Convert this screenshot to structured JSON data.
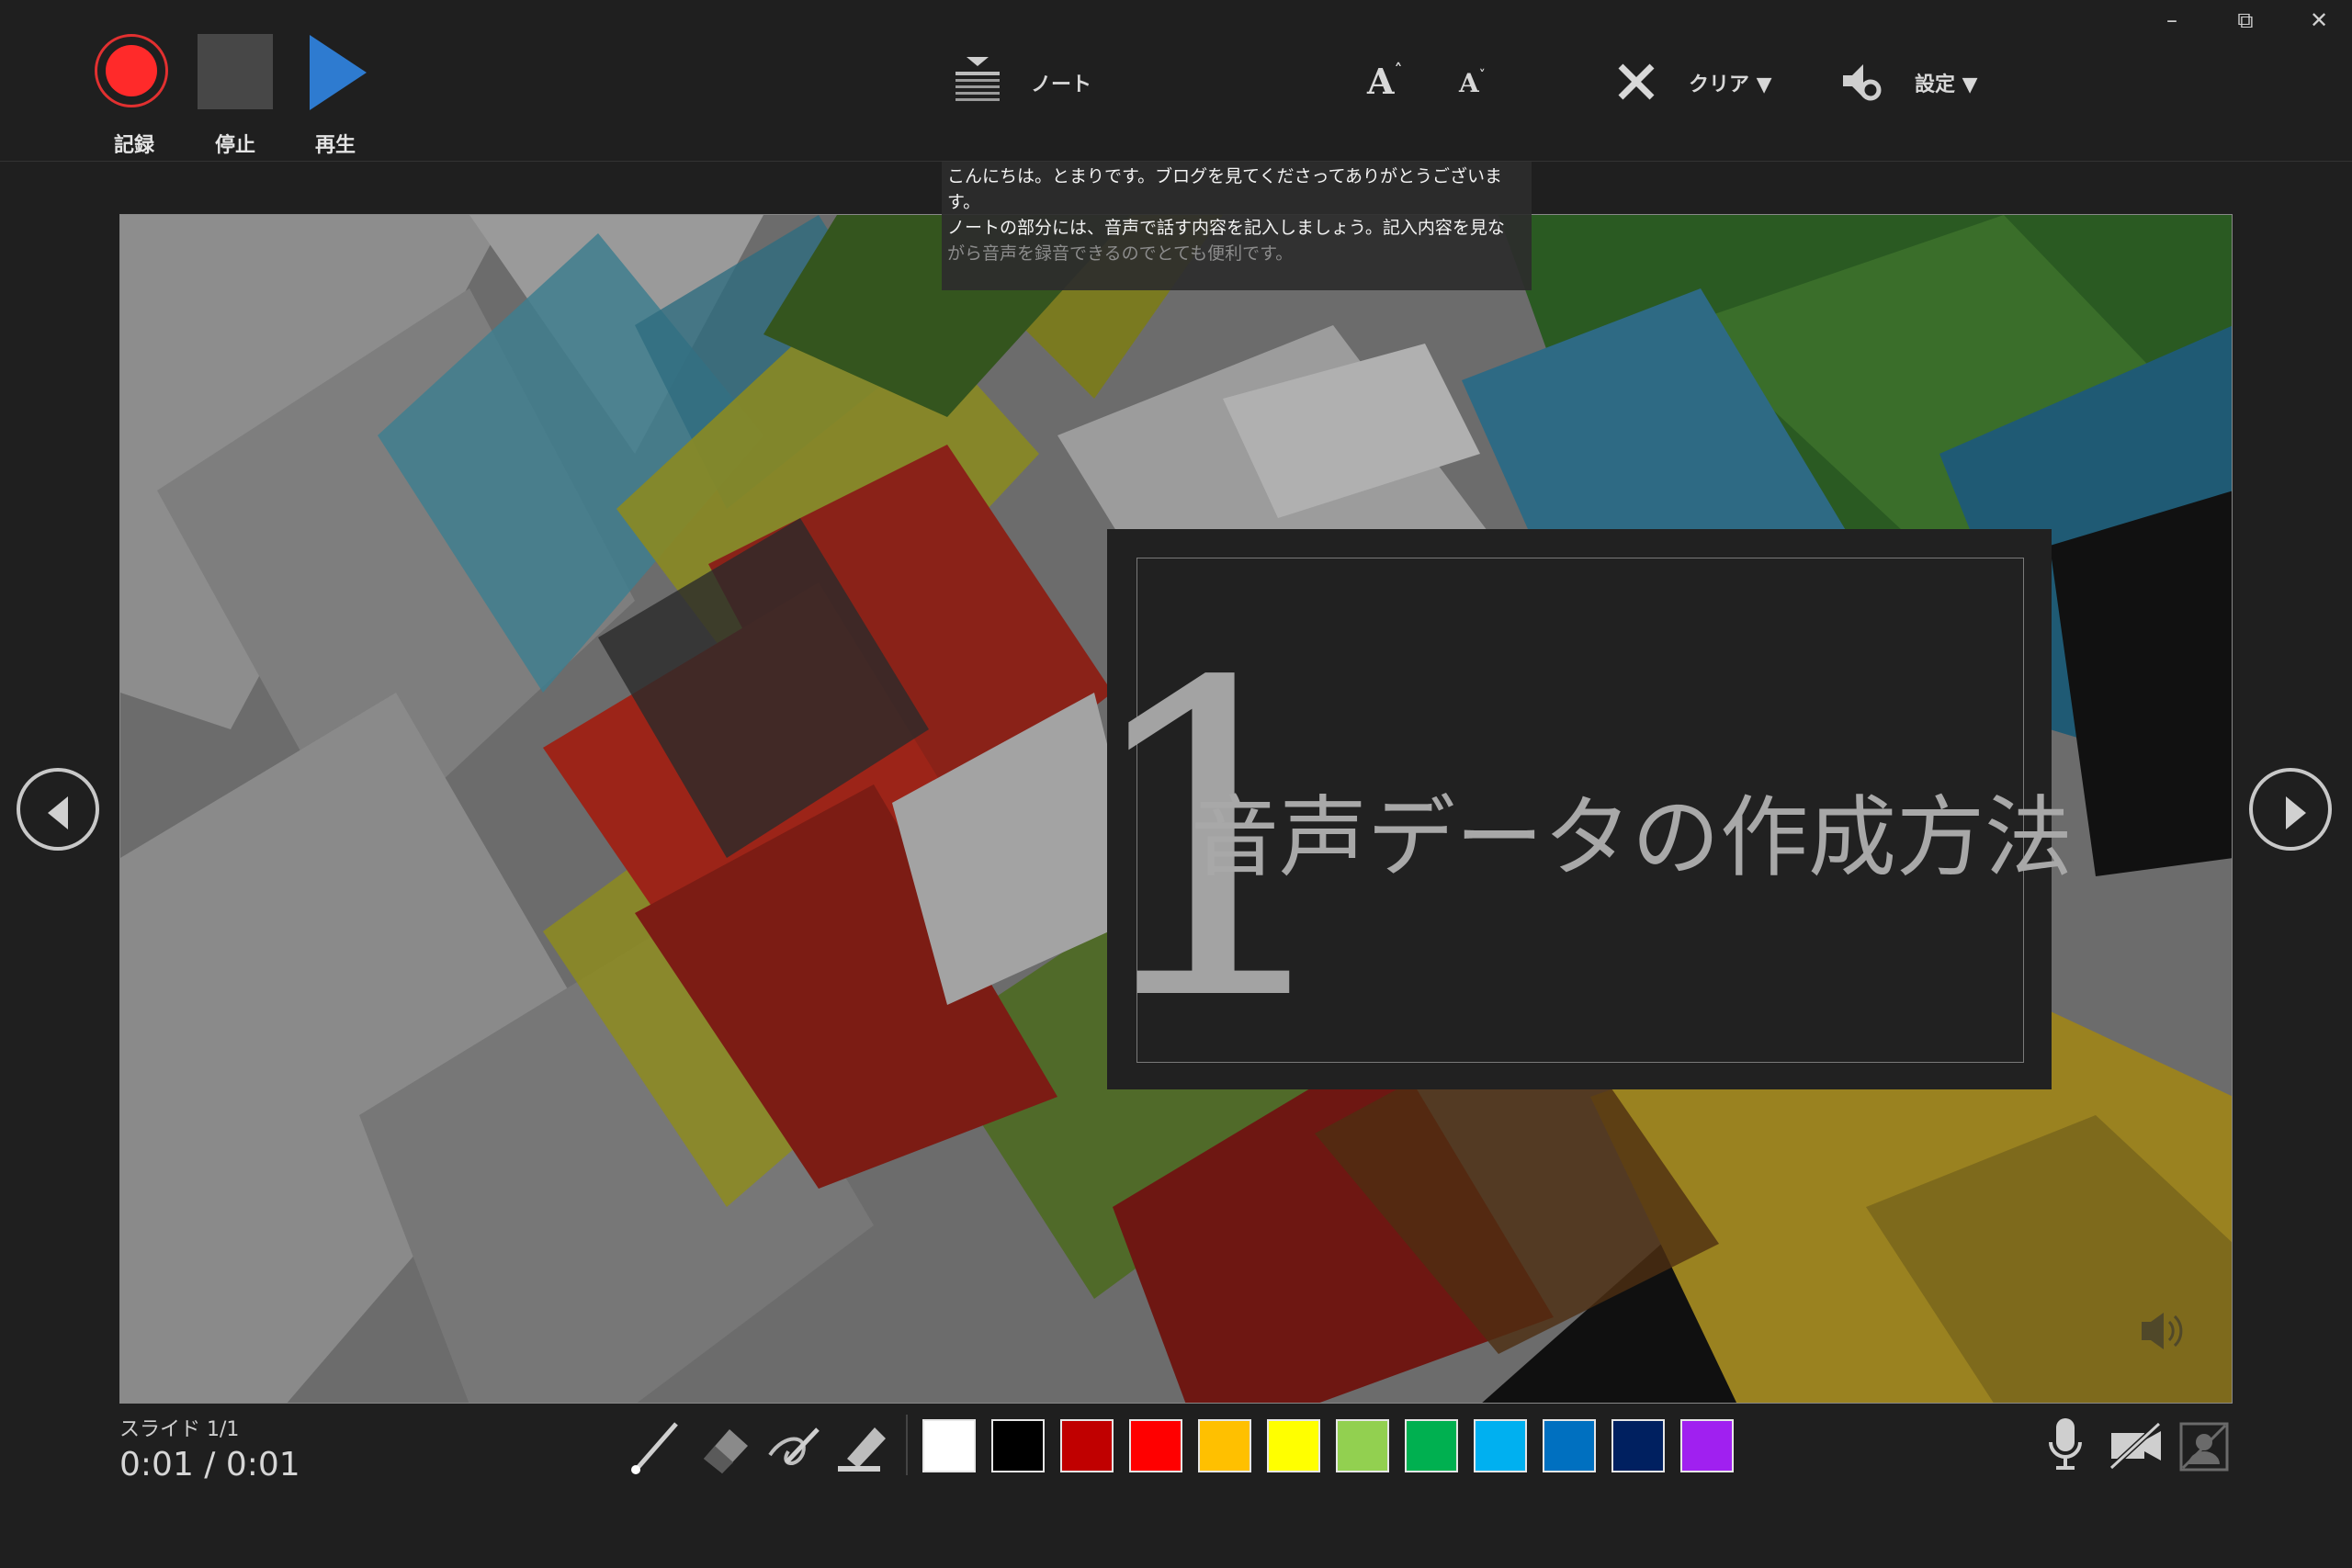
{
  "window": {
    "minimize": "–",
    "restore": "⧉",
    "close": "✕"
  },
  "toolbar": {
    "record_label": "記録",
    "stop_label": "停止",
    "play_label": "再生",
    "notes_label": "ノート",
    "clear_label": "クリア ▼",
    "settings_label": "設定 ▼",
    "font_increase": "A",
    "font_decrease": "A"
  },
  "notes": {
    "line1": "こんにちは。とまりです。ブログを見てくださってありがとうございます。",
    "line2": "ノートの部分には、音声で話す内容を記入しましょう。記入内容を見な",
    "line3": "がら音声を録音できるのでとても便利です。"
  },
  "slide": {
    "number": "1",
    "title": "音声データの作成方法"
  },
  "status": {
    "slide_counter": "スライド 1/1",
    "time": "0:01  /  0:01"
  },
  "colors": {
    "swatches": [
      "#ffffff",
      "#000000",
      "#c00000",
      "#ff0000",
      "#ffc000",
      "#ffff00",
      "#92d050",
      "#00b050",
      "#00b0f0",
      "#0070c0",
      "#002060",
      "#a020f0"
    ],
    "record": "#ff2a2a",
    "play": "#2e7bd0"
  },
  "icons": [
    "record-icon",
    "stop-icon",
    "play-icon",
    "notes-icon",
    "font-increase-icon",
    "font-decrease-icon",
    "clear-icon",
    "settings-icon",
    "pen-icon",
    "eraser-icon",
    "pen-ink-icon",
    "highlighter-icon",
    "microphone-icon",
    "camera-off-icon",
    "camera-preview-off-icon",
    "audio-icon"
  ]
}
